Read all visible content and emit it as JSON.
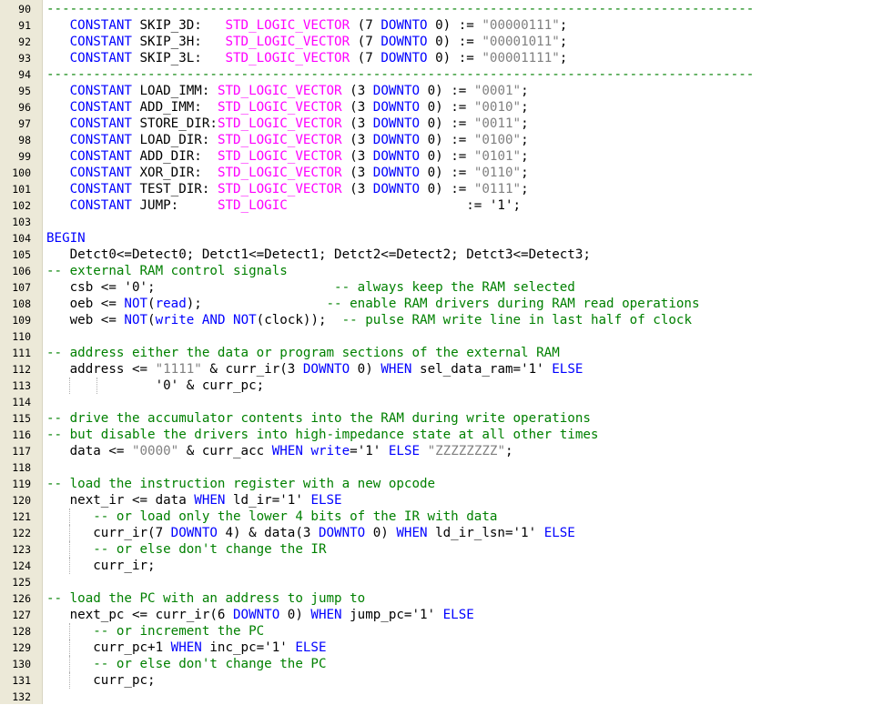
{
  "colors": {
    "keyword": "#0000ff",
    "type": "#ff00ff",
    "string": "#808080",
    "comment": "#008000",
    "default": "#000000",
    "gutter": "#ece9d8"
  },
  "lines": [
    {
      "num": "90",
      "guides": 0,
      "tokens": [
        [
          "sep",
          "-------------------------------------------------------------------------------------------"
        ]
      ]
    },
    {
      "num": "91",
      "guides": 0,
      "tokens": [
        [
          "",
          "   "
        ],
        [
          "kw",
          "CONSTANT"
        ],
        [
          "",
          " SKIP_3D:   "
        ],
        [
          "ty",
          "STD_LOGIC_VECTOR"
        ],
        [
          "",
          " (7 "
        ],
        [
          "kw",
          "DOWNTO"
        ],
        [
          "",
          " 0) := "
        ],
        [
          "str",
          "\"00000111\""
        ],
        [
          "",
          ";"
        ]
      ]
    },
    {
      "num": "92",
      "guides": 0,
      "tokens": [
        [
          "",
          "   "
        ],
        [
          "kw",
          "CONSTANT"
        ],
        [
          "",
          " SKIP_3H:   "
        ],
        [
          "ty",
          "STD_LOGIC_VECTOR"
        ],
        [
          "",
          " (7 "
        ],
        [
          "kw",
          "DOWNTO"
        ],
        [
          "",
          " 0) := "
        ],
        [
          "str",
          "\"00001011\""
        ],
        [
          "",
          ";"
        ]
      ]
    },
    {
      "num": "93",
      "guides": 0,
      "tokens": [
        [
          "",
          "   "
        ],
        [
          "kw",
          "CONSTANT"
        ],
        [
          "",
          " SKIP_3L:   "
        ],
        [
          "ty",
          "STD_LOGIC_VECTOR"
        ],
        [
          "",
          " (7 "
        ],
        [
          "kw",
          "DOWNTO"
        ],
        [
          "",
          " 0) := "
        ],
        [
          "str",
          "\"00001111\""
        ],
        [
          "",
          ";"
        ]
      ]
    },
    {
      "num": "94",
      "guides": 0,
      "tokens": [
        [
          "sep",
          "-------------------------------------------------------------------------------------------"
        ]
      ]
    },
    {
      "num": "95",
      "guides": 0,
      "tokens": [
        [
          "",
          "   "
        ],
        [
          "kw",
          "CONSTANT"
        ],
        [
          "",
          " LOAD_IMM: "
        ],
        [
          "ty",
          "STD_LOGIC_VECTOR"
        ],
        [
          "",
          " (3 "
        ],
        [
          "kw",
          "DOWNTO"
        ],
        [
          "",
          " 0) := "
        ],
        [
          "str",
          "\"0001\""
        ],
        [
          "",
          ";"
        ]
      ]
    },
    {
      "num": "96",
      "guides": 0,
      "tokens": [
        [
          "",
          "   "
        ],
        [
          "kw",
          "CONSTANT"
        ],
        [
          "",
          " ADD_IMM:  "
        ],
        [
          "ty",
          "STD_LOGIC_VECTOR"
        ],
        [
          "",
          " (3 "
        ],
        [
          "kw",
          "DOWNTO"
        ],
        [
          "",
          " 0) := "
        ],
        [
          "str",
          "\"0010\""
        ],
        [
          "",
          ";"
        ]
      ]
    },
    {
      "num": "97",
      "guides": 0,
      "tokens": [
        [
          "",
          "   "
        ],
        [
          "kw",
          "CONSTANT"
        ],
        [
          "",
          " STORE_DIR:"
        ],
        [
          "ty",
          "STD_LOGIC_VECTOR"
        ],
        [
          "",
          " (3 "
        ],
        [
          "kw",
          "DOWNTO"
        ],
        [
          "",
          " 0) := "
        ],
        [
          "str",
          "\"0011\""
        ],
        [
          "",
          ";"
        ]
      ]
    },
    {
      "num": "98",
      "guides": 0,
      "tokens": [
        [
          "",
          "   "
        ],
        [
          "kw",
          "CONSTANT"
        ],
        [
          "",
          " LOAD_DIR: "
        ],
        [
          "ty",
          "STD_LOGIC_VECTOR"
        ],
        [
          "",
          " (3 "
        ],
        [
          "kw",
          "DOWNTO"
        ],
        [
          "",
          " 0) := "
        ],
        [
          "str",
          "\"0100\""
        ],
        [
          "",
          ";"
        ]
      ]
    },
    {
      "num": "99",
      "guides": 0,
      "tokens": [
        [
          "",
          "   "
        ],
        [
          "kw",
          "CONSTANT"
        ],
        [
          "",
          " ADD_DIR:  "
        ],
        [
          "ty",
          "STD_LOGIC_VECTOR"
        ],
        [
          "",
          " (3 "
        ],
        [
          "kw",
          "DOWNTO"
        ],
        [
          "",
          " 0) := "
        ],
        [
          "str",
          "\"0101\""
        ],
        [
          "",
          ";"
        ]
      ]
    },
    {
      "num": "100",
      "guides": 0,
      "tokens": [
        [
          "",
          "   "
        ],
        [
          "kw",
          "CONSTANT"
        ],
        [
          "",
          " XOR_DIR:  "
        ],
        [
          "ty",
          "STD_LOGIC_VECTOR"
        ],
        [
          "",
          " (3 "
        ],
        [
          "kw",
          "DOWNTO"
        ],
        [
          "",
          " 0) := "
        ],
        [
          "str",
          "\"0110\""
        ],
        [
          "",
          ";"
        ]
      ]
    },
    {
      "num": "101",
      "guides": 0,
      "tokens": [
        [
          "",
          "   "
        ],
        [
          "kw",
          "CONSTANT"
        ],
        [
          "",
          " TEST_DIR: "
        ],
        [
          "ty",
          "STD_LOGIC_VECTOR"
        ],
        [
          "",
          " (3 "
        ],
        [
          "kw",
          "DOWNTO"
        ],
        [
          "",
          " 0) := "
        ],
        [
          "str",
          "\"0111\""
        ],
        [
          "",
          ";"
        ]
      ]
    },
    {
      "num": "102",
      "guides": 0,
      "tokens": [
        [
          "",
          "   "
        ],
        [
          "kw",
          "CONSTANT"
        ],
        [
          "",
          " JUMP:     "
        ],
        [
          "ty",
          "STD_LOGIC"
        ],
        [
          "",
          "                       := '1';"
        ]
      ]
    },
    {
      "num": "103",
      "guides": 0,
      "tokens": []
    },
    {
      "num": "104",
      "guides": 0,
      "tokens": [
        [
          "kw",
          "BEGIN"
        ]
      ]
    },
    {
      "num": "105",
      "guides": 0,
      "tokens": [
        [
          "",
          "   Detct0<=Detect0; Detct1<=Detect1; Detct2<=Detect2; Detct3<=Detect3;"
        ]
      ]
    },
    {
      "num": "106",
      "guides": 0,
      "tokens": [
        [
          "cm",
          "-- external RAM control signals"
        ]
      ]
    },
    {
      "num": "107",
      "guides": 0,
      "tokens": [
        [
          "",
          "   csb <= '0';                       "
        ],
        [
          "cm",
          "-- always keep the RAM selected"
        ]
      ]
    },
    {
      "num": "108",
      "guides": 0,
      "tokens": [
        [
          "",
          "   oeb <= "
        ],
        [
          "kw",
          "NOT"
        ],
        [
          "",
          "("
        ],
        [
          "kw",
          "read"
        ],
        [
          "",
          "); "
        ],
        [
          "",
          "               "
        ],
        [
          "cm",
          "-- enable RAM drivers during RAM read operations"
        ]
      ]
    },
    {
      "num": "109",
      "guides": 0,
      "tokens": [
        [
          "",
          "   web <= "
        ],
        [
          "kw",
          "NOT"
        ],
        [
          "",
          "("
        ],
        [
          "kw",
          "write"
        ],
        [
          "",
          " "
        ],
        [
          "kw",
          "AND"
        ],
        [
          "",
          " "
        ],
        [
          "kw",
          "NOT"
        ],
        [
          "",
          "(clock));  "
        ],
        [
          "cm",
          "-- pulse RAM write line in last half of clock"
        ]
      ]
    },
    {
      "num": "110",
      "guides": 0,
      "tokens": []
    },
    {
      "num": "111",
      "guides": 0,
      "tokens": [
        [
          "cm",
          "-- address either the data or program sections of the external RAM"
        ]
      ]
    },
    {
      "num": "112",
      "guides": 0,
      "tokens": [
        [
          "",
          "   address <= "
        ],
        [
          "str",
          "\"1111\""
        ],
        [
          "",
          " & curr_ir(3 "
        ],
        [
          "kw",
          "DOWNTO"
        ],
        [
          "",
          " 0) "
        ],
        [
          "kw",
          "WHEN"
        ],
        [
          "",
          " sel_data_ram='1' "
        ],
        [
          "kw",
          "ELSE"
        ]
      ]
    },
    {
      "num": "113",
      "guides": 2,
      "tokens": [
        [
          "",
          "              '0' & curr_pc;"
        ]
      ]
    },
    {
      "num": "114",
      "guides": 0,
      "tokens": []
    },
    {
      "num": "115",
      "guides": 0,
      "tokens": [
        [
          "cm",
          "-- drive the accumulator contents into the RAM during write operations"
        ]
      ]
    },
    {
      "num": "116",
      "guides": 0,
      "tokens": [
        [
          "cm",
          "-- but disable the drivers into high-impedance state at all other times"
        ]
      ]
    },
    {
      "num": "117",
      "guides": 0,
      "tokens": [
        [
          "",
          "   data <= "
        ],
        [
          "str",
          "\"0000\""
        ],
        [
          "",
          " & curr_acc "
        ],
        [
          "kw",
          "WHEN"
        ],
        [
          "",
          " "
        ],
        [
          "kw",
          "write"
        ],
        [
          "",
          "='1' "
        ],
        [
          "kw",
          "ELSE"
        ],
        [
          "",
          " "
        ],
        [
          "str",
          "\"ZZZZZZZZ\""
        ],
        [
          "",
          ";"
        ]
      ]
    },
    {
      "num": "118",
      "guides": 0,
      "tokens": []
    },
    {
      "num": "119",
      "guides": 0,
      "tokens": [
        [
          "cm",
          "-- load the instruction register with a new opcode"
        ]
      ]
    },
    {
      "num": "120",
      "guides": 0,
      "tokens": [
        [
          "",
          "   next_ir <= data "
        ],
        [
          "kw",
          "WHEN"
        ],
        [
          "",
          " ld_ir='1' "
        ],
        [
          "kw",
          "ELSE"
        ]
      ]
    },
    {
      "num": "121",
      "guides": 1,
      "tokens": [
        [
          "",
          "      "
        ],
        [
          "cm",
          "-- or load only the lower 4 bits of the IR with data"
        ]
      ]
    },
    {
      "num": "122",
      "guides": 1,
      "tokens": [
        [
          "",
          "      curr_ir(7 "
        ],
        [
          "kw",
          "DOWNTO"
        ],
        [
          "",
          " 4) & data(3 "
        ],
        [
          "kw",
          "DOWNTO"
        ],
        [
          "",
          " 0) "
        ],
        [
          "kw",
          "WHEN"
        ],
        [
          "",
          " ld_ir_lsn='1' "
        ],
        [
          "kw",
          "ELSE"
        ]
      ]
    },
    {
      "num": "123",
      "guides": 1,
      "tokens": [
        [
          "",
          "      "
        ],
        [
          "cm",
          "-- or else don't change the IR"
        ]
      ]
    },
    {
      "num": "124",
      "guides": 1,
      "tokens": [
        [
          "",
          "      curr_ir;"
        ]
      ]
    },
    {
      "num": "125",
      "guides": 0,
      "tokens": []
    },
    {
      "num": "126",
      "guides": 0,
      "tokens": [
        [
          "cm",
          "-- load the PC with an address to jump to"
        ]
      ]
    },
    {
      "num": "127",
      "guides": 0,
      "tokens": [
        [
          "",
          "   next_pc <= curr_ir(6 "
        ],
        [
          "kw",
          "DOWNTO"
        ],
        [
          "",
          " 0) "
        ],
        [
          "kw",
          "WHEN"
        ],
        [
          "",
          " jump_pc='1' "
        ],
        [
          "kw",
          "ELSE"
        ]
      ]
    },
    {
      "num": "128",
      "guides": 1,
      "tokens": [
        [
          "",
          "      "
        ],
        [
          "cm",
          "-- or increment the PC"
        ]
      ]
    },
    {
      "num": "129",
      "guides": 1,
      "tokens": [
        [
          "",
          "      curr_pc+1 "
        ],
        [
          "kw",
          "WHEN"
        ],
        [
          "",
          " inc_pc='1' "
        ],
        [
          "kw",
          "ELSE"
        ]
      ]
    },
    {
      "num": "130",
      "guides": 1,
      "tokens": [
        [
          "",
          "      "
        ],
        [
          "cm",
          "-- or else don't change the PC"
        ]
      ]
    },
    {
      "num": "131",
      "guides": 1,
      "tokens": [
        [
          "",
          "      curr_pc;"
        ]
      ]
    },
    {
      "num": "132",
      "guides": 0,
      "tokens": []
    }
  ]
}
